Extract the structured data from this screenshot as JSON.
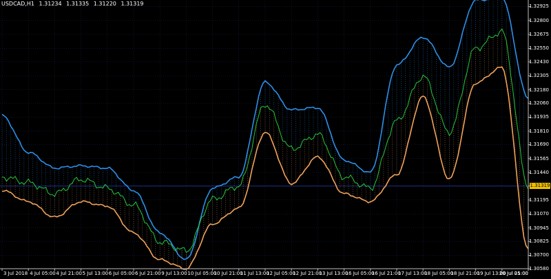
{
  "header": {
    "symbol_timeframe": "USDCAD,H1",
    "open": "1.31234",
    "high": "1.31335",
    "low": "1.31220",
    "close": "1.31319"
  },
  "current_price": "1.31319",
  "colors": {
    "background": "#000000",
    "upper_band": "#2e8fe8",
    "lower_band": "#f2a35a",
    "price_line": "#27c83a",
    "grid": "#1a2a5a",
    "current_price_line": "#1d2f8a",
    "current_price_label": "#f0c000",
    "axis": "#c0c0c0"
  },
  "chart_data": {
    "type": "line",
    "title": "USDCAD,H1",
    "xlabel": "",
    "ylabel": "",
    "ylim": [
      1.3058,
      1.3297
    ],
    "grid": true,
    "y_ticks": [
      "1.32925",
      "1.32800",
      "1.32675",
      "1.32550",
      "1.32430",
      "1.32305",
      "1.32180",
      "1.32060",
      "1.31935",
      "1.31810",
      "1.31690",
      "1.31565",
      "1.31440",
      "1.31319",
      "1.31195",
      "1.31070",
      "1.30945",
      "1.30825",
      "1.30700",
      "1.30580"
    ],
    "x_ticks": [
      "3 Jul 2018",
      "4 Jul 05:00",
      "4 Jul 21:00",
      "5 Jul 13:00",
      "6 Jul 05:00",
      "6 Jul 21:00",
      "9 Jul 13:00",
      "10 Jul 05:00",
      "10 Jul 21:00",
      "11 Jul 13:00",
      "12 Jul 05:00",
      "12 Jul 21:00",
      "13 Jul 13:00",
      "16 Jul 05:00",
      "16 Jul 21:00",
      "17 Jul 13:00",
      "18 Jul 05:00",
      "18 Jul 21:00",
      "19 Jul 13:00",
      "20 Jul 05:00",
      "20 Jul 21:00"
    ],
    "x": [
      0,
      5,
      10,
      15,
      20,
      25,
      30,
      35,
      40,
      45,
      50,
      55,
      60,
      65,
      70,
      75,
      80,
      85,
      90,
      95,
      100
    ],
    "series": [
      {
        "name": "",
        "values": [
          1.3195,
          1.3162,
          1.3148,
          1.315,
          1.3148,
          1.3128,
          1.309,
          1.3066,
          1.313,
          1.314,
          1.3225,
          1.32,
          1.3202,
          1.3155,
          1.3144,
          1.324,
          1.3265,
          1.3238,
          1.3298,
          1.33,
          1.321
        ]
      },
      {
        "name": "",
        "values": [
          1.314,
          1.3135,
          1.3125,
          1.3138,
          1.313,
          1.3115,
          1.3082,
          1.3074,
          1.312,
          1.3132,
          1.3205,
          1.3165,
          1.3178,
          1.314,
          1.313,
          1.319,
          1.323,
          1.318,
          1.3255,
          1.327,
          1.3132
        ]
      },
      {
        "name": "",
        "values": [
          1.3128,
          1.3118,
          1.3104,
          1.3118,
          1.3114,
          1.309,
          1.3066,
          1.3058,
          1.3098,
          1.3112,
          1.318,
          1.3134,
          1.3158,
          1.3125,
          1.3118,
          1.3142,
          1.3212,
          1.3138,
          1.3224,
          1.3238,
          1.3075
        ]
      }
    ]
  }
}
